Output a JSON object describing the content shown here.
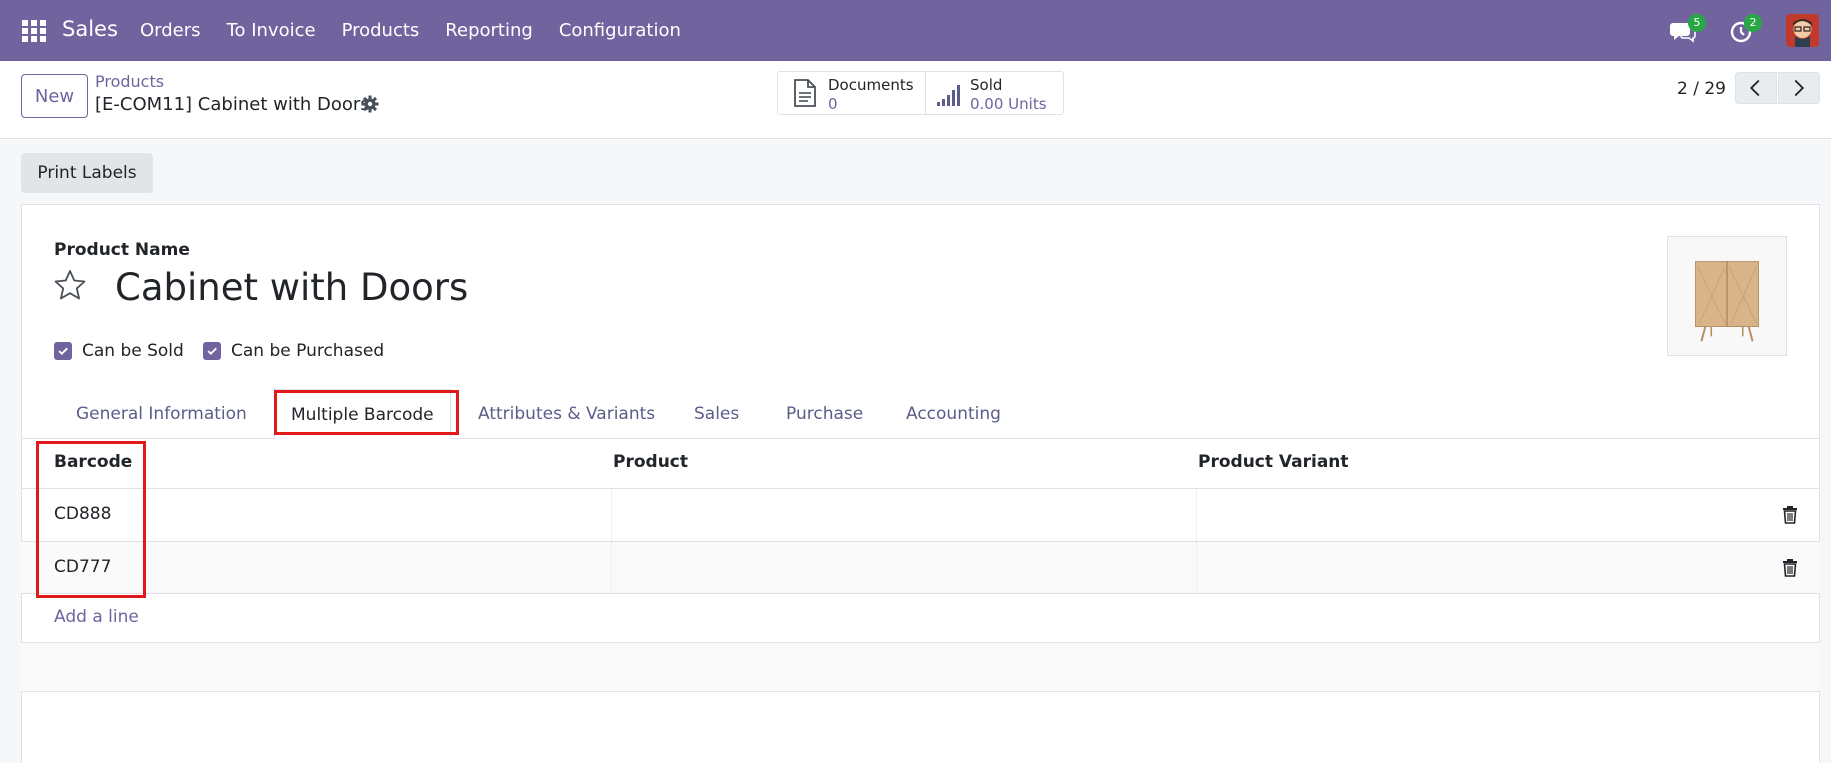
{
  "navbar": {
    "app_name": "Sales",
    "menu": [
      "Orders",
      "To Invoice",
      "Products",
      "Reporting",
      "Configuration"
    ],
    "chat_badge": "5",
    "activity_badge": "2",
    "bg_color": "#71639e"
  },
  "control_panel": {
    "new_label": "New",
    "breadcrumb": "Products",
    "record_title": "[E-COM11] Cabinet with Doors",
    "stats": {
      "documents_label": "Documents",
      "documents_value": "0",
      "sold_label": "Sold",
      "sold_value": "0.00 Units"
    },
    "pager": "2 / 29"
  },
  "actions": {
    "print_labels": "Print Labels"
  },
  "form": {
    "name_label": "Product Name",
    "product_name": "Cabinet with Doors",
    "can_be_sold": "Can be Sold",
    "can_be_purchased": "Can be Purchased",
    "tabs": [
      "General Information",
      "Multiple Barcode",
      "Attributes & Variants",
      "Sales",
      "Purchase",
      "Accounting"
    ],
    "active_tab": "Multiple Barcode"
  },
  "barcode_table": {
    "columns": [
      "Barcode",
      "Product",
      "Product Variant"
    ],
    "rows": [
      {
        "barcode": "CD888",
        "product": "",
        "variant": ""
      },
      {
        "barcode": "CD777",
        "product": "",
        "variant": ""
      }
    ],
    "add_line": "Add a line"
  },
  "icons": [
    "apps-grid-icon",
    "chat-icon",
    "activity-clock-icon",
    "gear-icon",
    "document-icon",
    "bar-chart-icon",
    "chevron-left-icon",
    "chevron-right-icon",
    "star-icon",
    "checkmark-icon",
    "trash-icon"
  ],
  "colors": {
    "accent": "#71639e",
    "highlight": "#e0191b"
  }
}
